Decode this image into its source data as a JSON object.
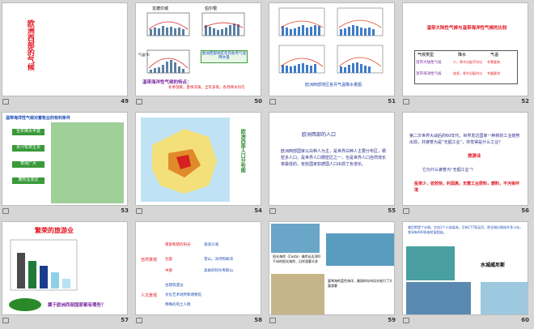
{
  "slides": [
    {
      "num": "49",
      "text": "欧洲西部的气候"
    },
    {
      "num": "50",
      "chart_left_title": "龙德尔城",
      "chart_right_title": "伯尔根",
      "caption_left": "气温/℃",
      "caption_right": "降水量/mm",
      "box_text": "欧洲西部地区年内各月气温降水量",
      "note_title": "温带海洋性气候的特点：",
      "note_body": "冬季温暖，夏季凉爽，全年多雨，各月降水均匀"
    },
    {
      "num": "51",
      "caption": "欧洲西部地区各月气温降水量图"
    },
    {
      "num": "52",
      "title": "温带大陆性气候与温带海洋性气候的比较",
      "table_header": [
        "气候类型",
        "降水",
        "气温"
      ],
      "rows": [
        [
          "温带大陆性气候",
          "少，季节分配不均匀",
          "冬寒夏热"
        ],
        [
          "温带海洋性气候",
          "较多，季节分配均匀",
          "冬暖夏凉"
        ]
      ]
    },
    {
      "num": "53",
      "title": "温带海洋性气候对畜牧业的有利条件",
      "steps": [
        "全年降水丰富",
        "多汁牧草生长",
        "草场广大",
        "畜牧业发达"
      ]
    },
    {
      "num": "54",
      "side_text": "欧洲西部人口分布图"
    },
    {
      "num": "55",
      "title": "欧洲西部的人口",
      "body": "欧洲西部国家以白种人为主，是世界白种人主要分布区，稠密多人口，是世界人口稠密区之一，也是世界人口自然增长率最低的，有些国家如德国人口出现了负增长。"
    },
    {
      "num": "56",
      "q1": "第二次世界大战后的60年代，世界发达国家一种新的工业趋势出现，并被誉为是“无烟工业”，你觉得是什么工业？",
      "a1": "旅游业",
      "q2": "它为什么被誉为“无烟工业”？",
      "a2": "投资少，收效快，利润高，无需工业原料，燃料，不污染环境"
    },
    {
      "num": "57",
      "title": "繁荣的旅游业",
      "question": "属于欧洲西部国家都有哪些？"
    },
    {
      "num": "58",
      "groups": [
        {
          "label": "自然景观",
          "items": [
            "南部希腊的阳光",
            "北部",
            "中部"
          ],
          "subs": [
            "海滨沙滩",
            "雪山，冰河和峡湾",
            "高耸的阿尔卑斯山"
          ]
        },
        {
          "label": "人文景观",
          "items": [
            "古建筑遗址",
            "文化艺术场所和博物馆",
            "特殊的风土人情"
          ]
        }
      ]
    },
    {
      "num": "59",
      "text1": "阳光海岸（Costa）海岸长达300千米的阳光海岸，沿岸游客众多",
      "text2": "爱琴海的蓝色海洋，美丽的岛屿风光吸引了大量游客"
    },
    {
      "num": "60",
      "text": "威尼斯是个水城，它由1个小岛组成，又有177条运河，把全城分割成许多小岛，其间有400多座桥梁相连。",
      "label": "水城威尼斯"
    }
  ],
  "colors": {
    "accent": "#e0141f",
    "title_blue": "#1b4bb3",
    "purple": "#7a2aa0"
  }
}
